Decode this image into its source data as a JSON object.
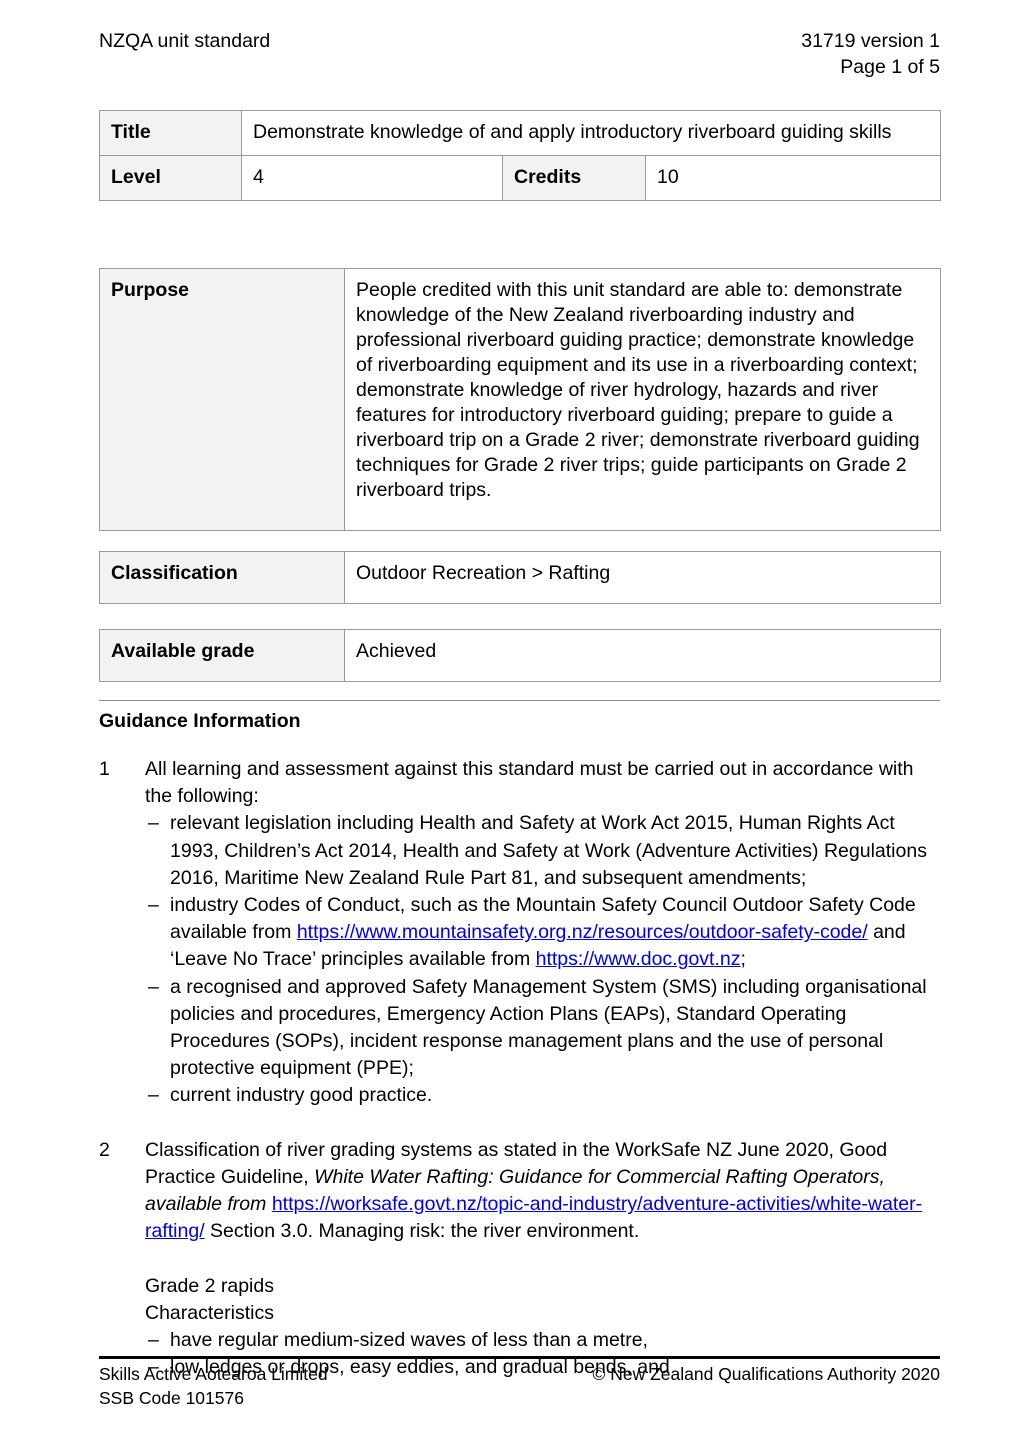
{
  "header": {
    "left": "NZQA unit standard",
    "right_line1": "31719 version 1",
    "right_line2": "Page 1 of 5"
  },
  "title_table": {
    "title_label": "Title",
    "title_value": "Demonstrate knowledge of and apply introductory riverboard guiding skills",
    "level_label": "Level",
    "level_value": "4",
    "credits_label": "Credits",
    "credits_value": "10"
  },
  "purpose_table": {
    "label": "Purpose",
    "value": "People credited with this unit standard are able to: demonstrate knowledge of the New Zealand riverboarding industry and professional riverboard guiding practice; demonstrate knowledge of riverboarding equipment and its use in a riverboarding context; demonstrate knowledge of river hydrology, hazards and river features for introductory riverboard guiding; prepare to guide a riverboard trip on a Grade 2 river; demonstrate riverboard guiding techniques for Grade 2 river trips; guide participants on Grade 2 riverboard trips."
  },
  "classification_table": {
    "label": "Classification",
    "value": "Outdoor Recreation > Rafting"
  },
  "grade_table": {
    "label": "Available grade",
    "value": "Achieved"
  },
  "guidance": {
    "heading": "Guidance Information",
    "item1": {
      "number": "1",
      "lead": "All learning and assessment against this standard must be carried out in accordance with the following:",
      "bullets": {
        "b1": "relevant legislation including Health and Safety at Work Act 2015, Human Rights Act 1993, Children’s Act 2014, Health and Safety at Work (Adventure Activities) Regulations 2016, Maritime New Zealand Rule Part 81, and subsequent amendments;",
        "b2_pre": "industry Codes of Conduct, such as the Mountain Safety Council Outdoor Safety Code available from ",
        "b2_link1": "https://www.mountainsafety.org.nz/resources/outdoor-safety-code/",
        "b2_mid": " and ‘Leave No Trace’ principles available from ",
        "b2_link2": "https://www.doc.govt.nz",
        "b2_post": ";",
        "b3": "a recognised and approved Safety Management System (SMS) including organisational policies and procedures, Emergency Action Plans (EAPs), Standard Operating Procedures (SOPs), incident response management plans and the use of personal protective equipment (PPE);",
        "b4": "current industry good practice."
      },
      "dash": "–"
    },
    "item2": {
      "number": "2",
      "pre": "Classification of river grading systems as stated in the WorkSafe NZ June 2020, Good Practice Guideline, ",
      "italic": "White Water Rafting: Guidance for Commercial Rafting Operators, available from ",
      "link": "https://worksafe.govt.nz/topic-and-industry/adventure-activities/white-water-rafting/",
      "post": " Section 3.0. Managing risk: the river environment.",
      "grade_heading1": "Grade 2 rapids",
      "grade_heading2": "Characteristics",
      "bullets": {
        "g1": "have regular medium-sized waves of less than a metre,",
        "g2": "low ledges or drops, easy eddies, and gradual bends, and"
      },
      "dash": "–"
    }
  },
  "footer": {
    "left": "Skills Active Aotearoa Limited\nSSB Code 101576",
    "right": "© New Zealand Qualifications Authority 2020"
  }
}
